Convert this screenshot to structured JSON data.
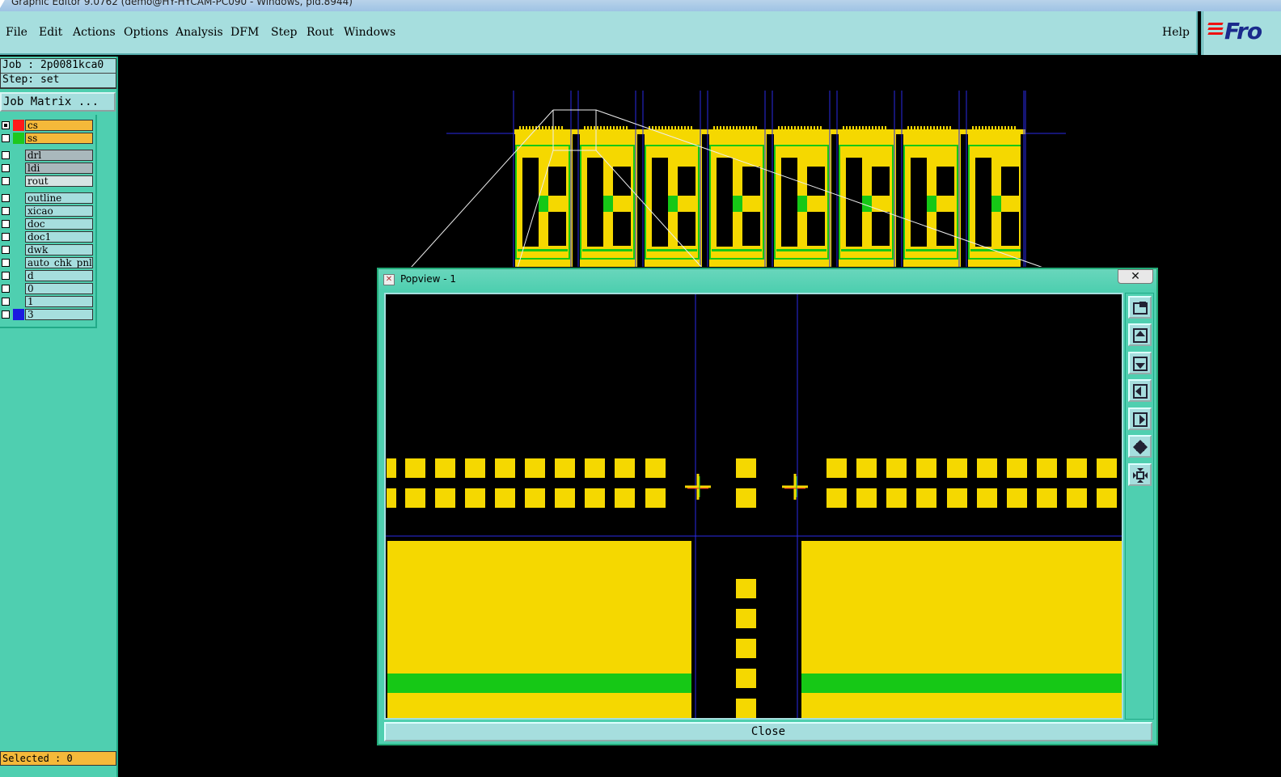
{
  "window": {
    "title": "Graphic Editor 9.0762 (demo@HY-HYCAM-PC090 - Windows, pid.8944)"
  },
  "menubar": {
    "items": [
      "File",
      "Edit",
      "Actions",
      "Options",
      "Analysis",
      "DFM",
      "Step",
      "Rout",
      "Windows"
    ],
    "help": "Help",
    "logo": "Fro"
  },
  "job": {
    "job_label": "Job : 2p0081kca0",
    "step_label": "Step: set",
    "matrix_button": "Job Matrix ..."
  },
  "layers": [
    {
      "name": "cs",
      "checked": true,
      "swatch": "#ff1a1a",
      "bg": "#f5b93a"
    },
    {
      "name": "ss",
      "checked": false,
      "swatch": "#1ec81e",
      "bg": "#f5b93a"
    },
    {
      "name": "drl",
      "checked": false,
      "swatch": "#4fcfb0",
      "bg": "#a9b8bc"
    },
    {
      "name": "ldi",
      "checked": false,
      "swatch": "#4fcfb0",
      "bg": "#a9b8bc"
    },
    {
      "name": "rout",
      "checked": false,
      "swatch": "#4fcfb0",
      "bg": "#d6e4e4"
    },
    {
      "name": "outline",
      "checked": false,
      "swatch": "#4fcfb0",
      "bg": "#a6dede"
    },
    {
      "name": "xicao",
      "checked": false,
      "swatch": "#4fcfb0",
      "bg": "#a6dede"
    },
    {
      "name": "doc",
      "checked": false,
      "swatch": "#4fcfb0",
      "bg": "#a6dede"
    },
    {
      "name": "doc1",
      "checked": false,
      "swatch": "#4fcfb0",
      "bg": "#a6dede"
    },
    {
      "name": "dwk",
      "checked": false,
      "swatch": "#4fcfb0",
      "bg": "#a6dede"
    },
    {
      "name": "auto_chk_pnl",
      "checked": false,
      "swatch": "#4fcfb0",
      "bg": "#a6dede"
    },
    {
      "name": "d",
      "checked": false,
      "swatch": "#4fcfb0",
      "bg": "#a6dede"
    },
    {
      "name": "0",
      "checked": false,
      "swatch": "#4fcfb0",
      "bg": "#a6dede"
    },
    {
      "name": "1",
      "checked": false,
      "swatch": "#4fcfb0",
      "bg": "#a6dede"
    },
    {
      "name": "3",
      "checked": false,
      "swatch": "#1a1ae0",
      "bg": "#a6dede"
    }
  ],
  "status": {
    "selected": "Selected : 0"
  },
  "popview": {
    "title": "Popview - 1",
    "close_x": "✕",
    "close_button": "Close",
    "side_buttons": [
      "zoom-window-icon",
      "pan-up-icon",
      "pan-down-icon",
      "pan-left-icon",
      "pan-right-icon",
      "zoom-out-icon",
      "zoom-in-icon"
    ]
  },
  "colors": {
    "copper": "#f5d800",
    "trace_green": "#16c816",
    "mask_magenta": "#c23ee0",
    "grid_blue": "#2a2ae6",
    "panel_cyan": "#a6dede",
    "panel_teal": "#4fcfb0"
  }
}
